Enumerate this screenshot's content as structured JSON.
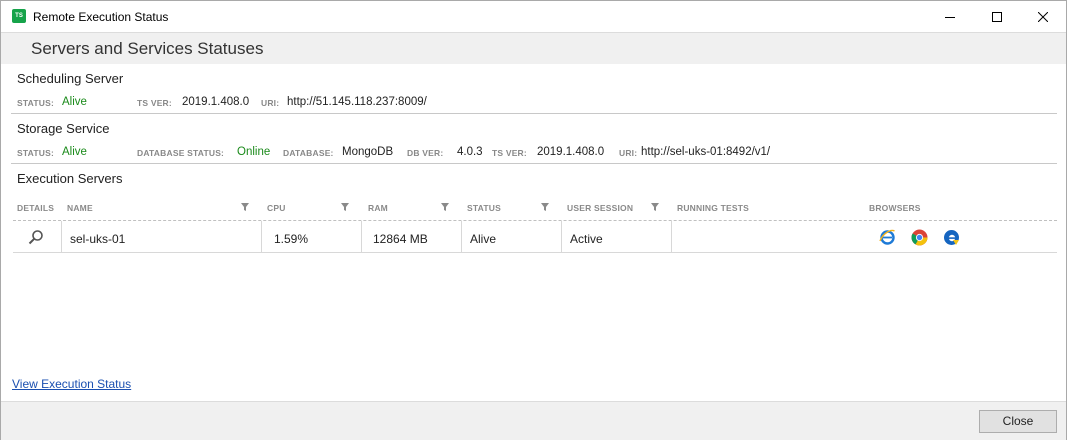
{
  "window": {
    "title": "Remote Execution Status",
    "app_icon_text": "TS"
  },
  "header": {
    "title": "Servers and Services Statuses"
  },
  "scheduling_server": {
    "title": "Scheduling Server",
    "status_label": "STATUS:",
    "status_value": "Alive",
    "ts_ver_label": "TS VER:",
    "ts_ver_value": "2019.1.408.0",
    "uri_label": "URI:",
    "uri_value": "http://51.145.118.237:8009/"
  },
  "storage_service": {
    "title": "Storage Service",
    "status_label": "STATUS:",
    "status_value": "Alive",
    "db_status_label": "DATABASE STATUS:",
    "db_status_value": "Online",
    "database_label": "DATABASE:",
    "database_value": "MongoDB",
    "db_ver_label": "DB VER:",
    "db_ver_value": "4.0.3",
    "ts_ver_label": "TS VER:",
    "ts_ver_value": "2019.1.408.0",
    "uri_label": "URI:",
    "uri_value": "http://sel-uks-01:8492/v1/"
  },
  "execution_servers": {
    "title": "Execution Servers",
    "columns": {
      "details": "DETAILS",
      "name": "NAME",
      "cpu": "CPU",
      "ram": "RAM",
      "status": "STATUS",
      "user_session": "USER SESSION",
      "running_tests": "RUNNING TESTS",
      "browsers": "BROWSERS"
    },
    "rows": [
      {
        "name": "sel-uks-01",
        "cpu": "1.59%",
        "ram": "12864 MB",
        "status": "Alive",
        "user_session": "Active",
        "running_tests": "",
        "browsers": [
          "internet-explorer-icon",
          "chrome-icon",
          "edge-icon"
        ]
      }
    ]
  },
  "footer": {
    "link": "View Execution Status",
    "close_button": "Close"
  },
  "colors": {
    "status_green": "#1a8a1a",
    "link_blue": "#1a4fb0",
    "band_gray": "#f0f0f0"
  }
}
